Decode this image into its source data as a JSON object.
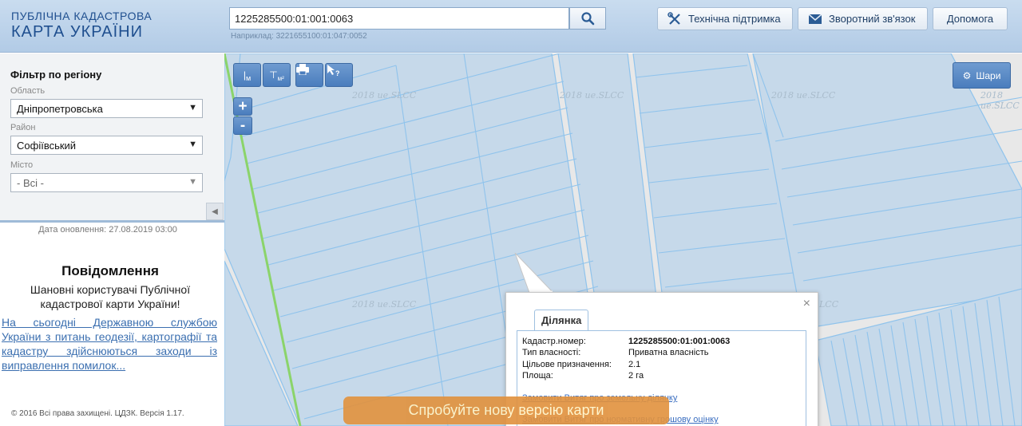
{
  "header": {
    "logo_line1": "ПУБЛІЧНА КАДАСТРОВА",
    "logo_line2": "КАРТА УКРАЇНИ",
    "search_value": "1225285500:01:001:0063",
    "search_hint": "Наприклад: 3221655100:01:047:0052",
    "buttons": {
      "support": "Технічна підтримка",
      "feedback": "Зворотний зв'язок",
      "help": "Допомога"
    }
  },
  "sidebar": {
    "filter_title": "Фільтр по регіону",
    "oblast_label": "Область",
    "oblast_value": "Дніпропетровська",
    "district_label": "Район",
    "district_value": "Софіївський",
    "city_label": "Місто",
    "city_value": "- Всі -",
    "update_date": "Дата оновлення: 27.08.2019 03:00",
    "notice_title": "Повідомлення",
    "notice_body": "Шановні користувачі Публічної кадастрової карти України!",
    "notice_link": "На сьогодні Державною службою України з питань геодезії, картографії та кадастру здійснюються заходи із виправлення помилок...",
    "copyright": "© 2016 Всі права захищені. ЦДЗК. Версія 1.17."
  },
  "map": {
    "tools": {
      "measure_label": "м",
      "area_label": "м²",
      "layers_label": "Шари"
    },
    "zoom_in": "+",
    "zoom_out": "-",
    "watermark": "2018 ue.SLCC",
    "watermark_partial": "LCC",
    "popup": {
      "tab_label": "Ділянка",
      "close": "×",
      "cadastral_label": "Кадастр.номер:",
      "cadastral_value": "1225285500:01:001:0063",
      "ownership_label": "Тип власності:",
      "ownership_value": "Приватна власність",
      "purpose_label": "Цільове призначення:",
      "purpose_value": "2.1",
      "area_label": "Площа:",
      "area_value": "2 га",
      "link1": "Замовити Витяг про земельну ділянку",
      "link2": "Замовити Витяг про нормативну грошову оцінку"
    },
    "new_version_banner": "Спробуйте нову версію карти"
  },
  "colors": {
    "parcel_fill": "#c6d9ea",
    "parcel_line": "#8fc3ec",
    "boundary_green": "#8bd46a",
    "accent_blue": "#4a7dbd"
  }
}
